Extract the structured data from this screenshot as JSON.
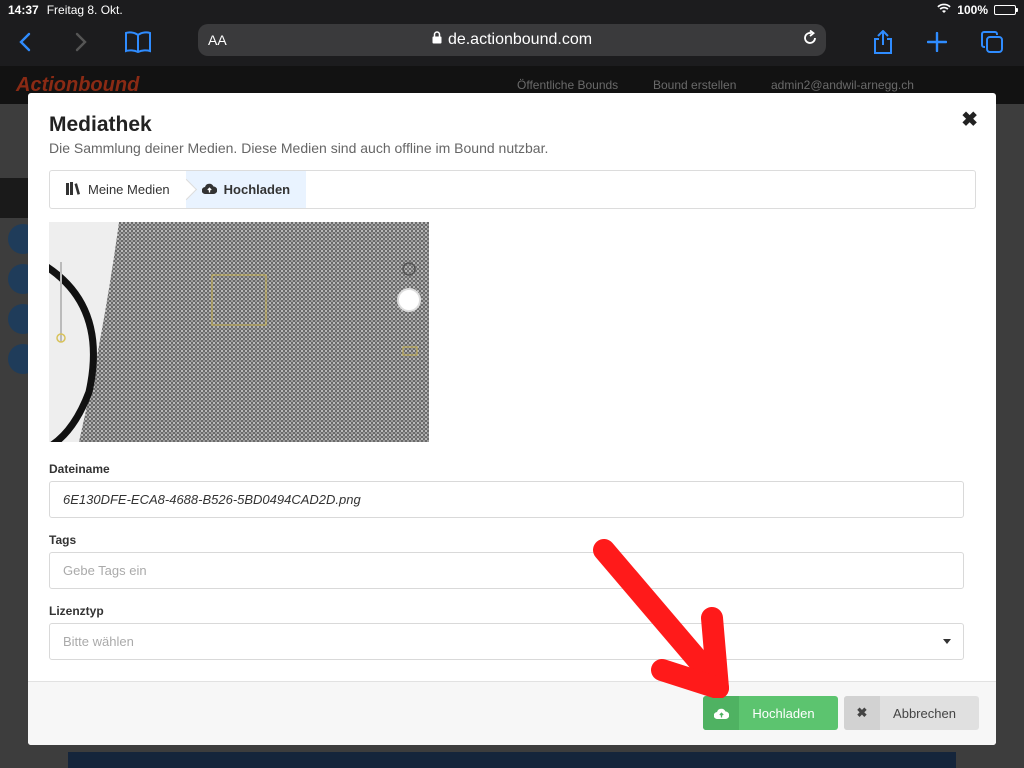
{
  "statusbar": {
    "time": "14:37",
    "date": "Freitag 8. Okt.",
    "battery": "100%",
    "battery_level": 1.0
  },
  "browser": {
    "text_size_label": "AA",
    "url": "de.actionbound.com"
  },
  "site": {
    "logo": "Actionbound",
    "nav": [
      "Öffentliche Bounds",
      "Bound erstellen",
      "admin2@andwil-arnegg.ch"
    ]
  },
  "modal": {
    "title": "Mediathek",
    "subtitle": "Die Sammlung deiner Medien. Diese Medien sind auch offline im Bound nutzbar.",
    "tabs": [
      {
        "label": "Meine Medien",
        "icon": "books-icon",
        "active": false
      },
      {
        "label": "Hochladen",
        "icon": "cloud-upload-icon",
        "active": true
      }
    ],
    "form": {
      "filename_label": "Dateiname",
      "filename_value": "6E130DFE-ECA8-4688-B526-5BD0494CAD2D.png",
      "tags_label": "Tags",
      "tags_placeholder": "Gebe Tags ein",
      "license_label": "Lizenztyp",
      "license_placeholder": "Bitte wählen"
    },
    "buttons": {
      "upload": "Hochladen",
      "cancel": "Abbrechen"
    }
  },
  "colors": {
    "accent_green": "#5cc46f",
    "annotation_red": "#ff1a1a",
    "ios_blue": "#2f8cff"
  }
}
